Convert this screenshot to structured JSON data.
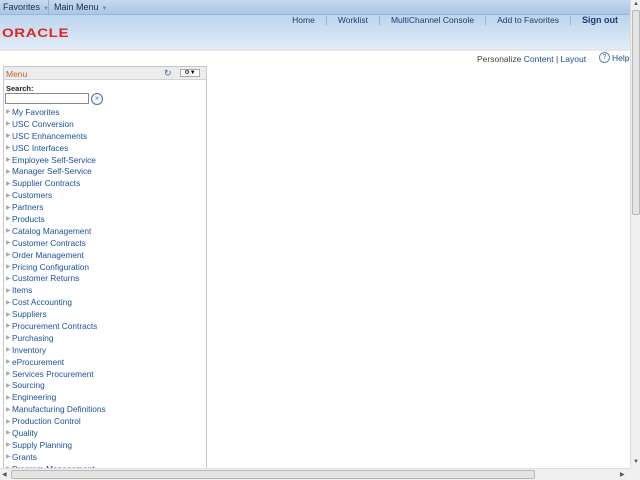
{
  "topbar": {
    "favorites": "Favorites",
    "main_menu": "Main Menu"
  },
  "header": {
    "logo": "ORACLE",
    "nav": [
      "Home",
      "Worklist",
      "MultiChannel Console",
      "Add to Favorites"
    ],
    "signout": "Sign out"
  },
  "page": {
    "personalize": "Personalize",
    "content": "Content",
    "separator": "|",
    "layout": "Layout",
    "help": "Help"
  },
  "menu": {
    "title": "Menu",
    "search_label": "Search:",
    "search_value": "",
    "items": [
      "My Favorites",
      "USC Conversion",
      "USC Enhancements",
      "USC Interfaces",
      "Employee Self-Service",
      "Manager Self-Service",
      "Supplier Contracts",
      "Customers",
      "Partners",
      "Products",
      "Catalog Management",
      "Customer Contracts",
      "Order Management",
      "Pricing Configuration",
      "Customer Returns",
      "Items",
      "Cost Accounting",
      "Suppliers",
      "Procurement Contracts",
      "Purchasing",
      "Inventory",
      "eProcurement",
      "Services Procurement",
      "Sourcing",
      "Engineering",
      "Manufacturing Definitions",
      "Production Control",
      "Quality",
      "Supply Planning",
      "Grants",
      "Program Management"
    ]
  },
  "colors": {
    "brand": "#e0251b",
    "link": "#1d4f9a",
    "menu_title": "#b06a2a"
  }
}
